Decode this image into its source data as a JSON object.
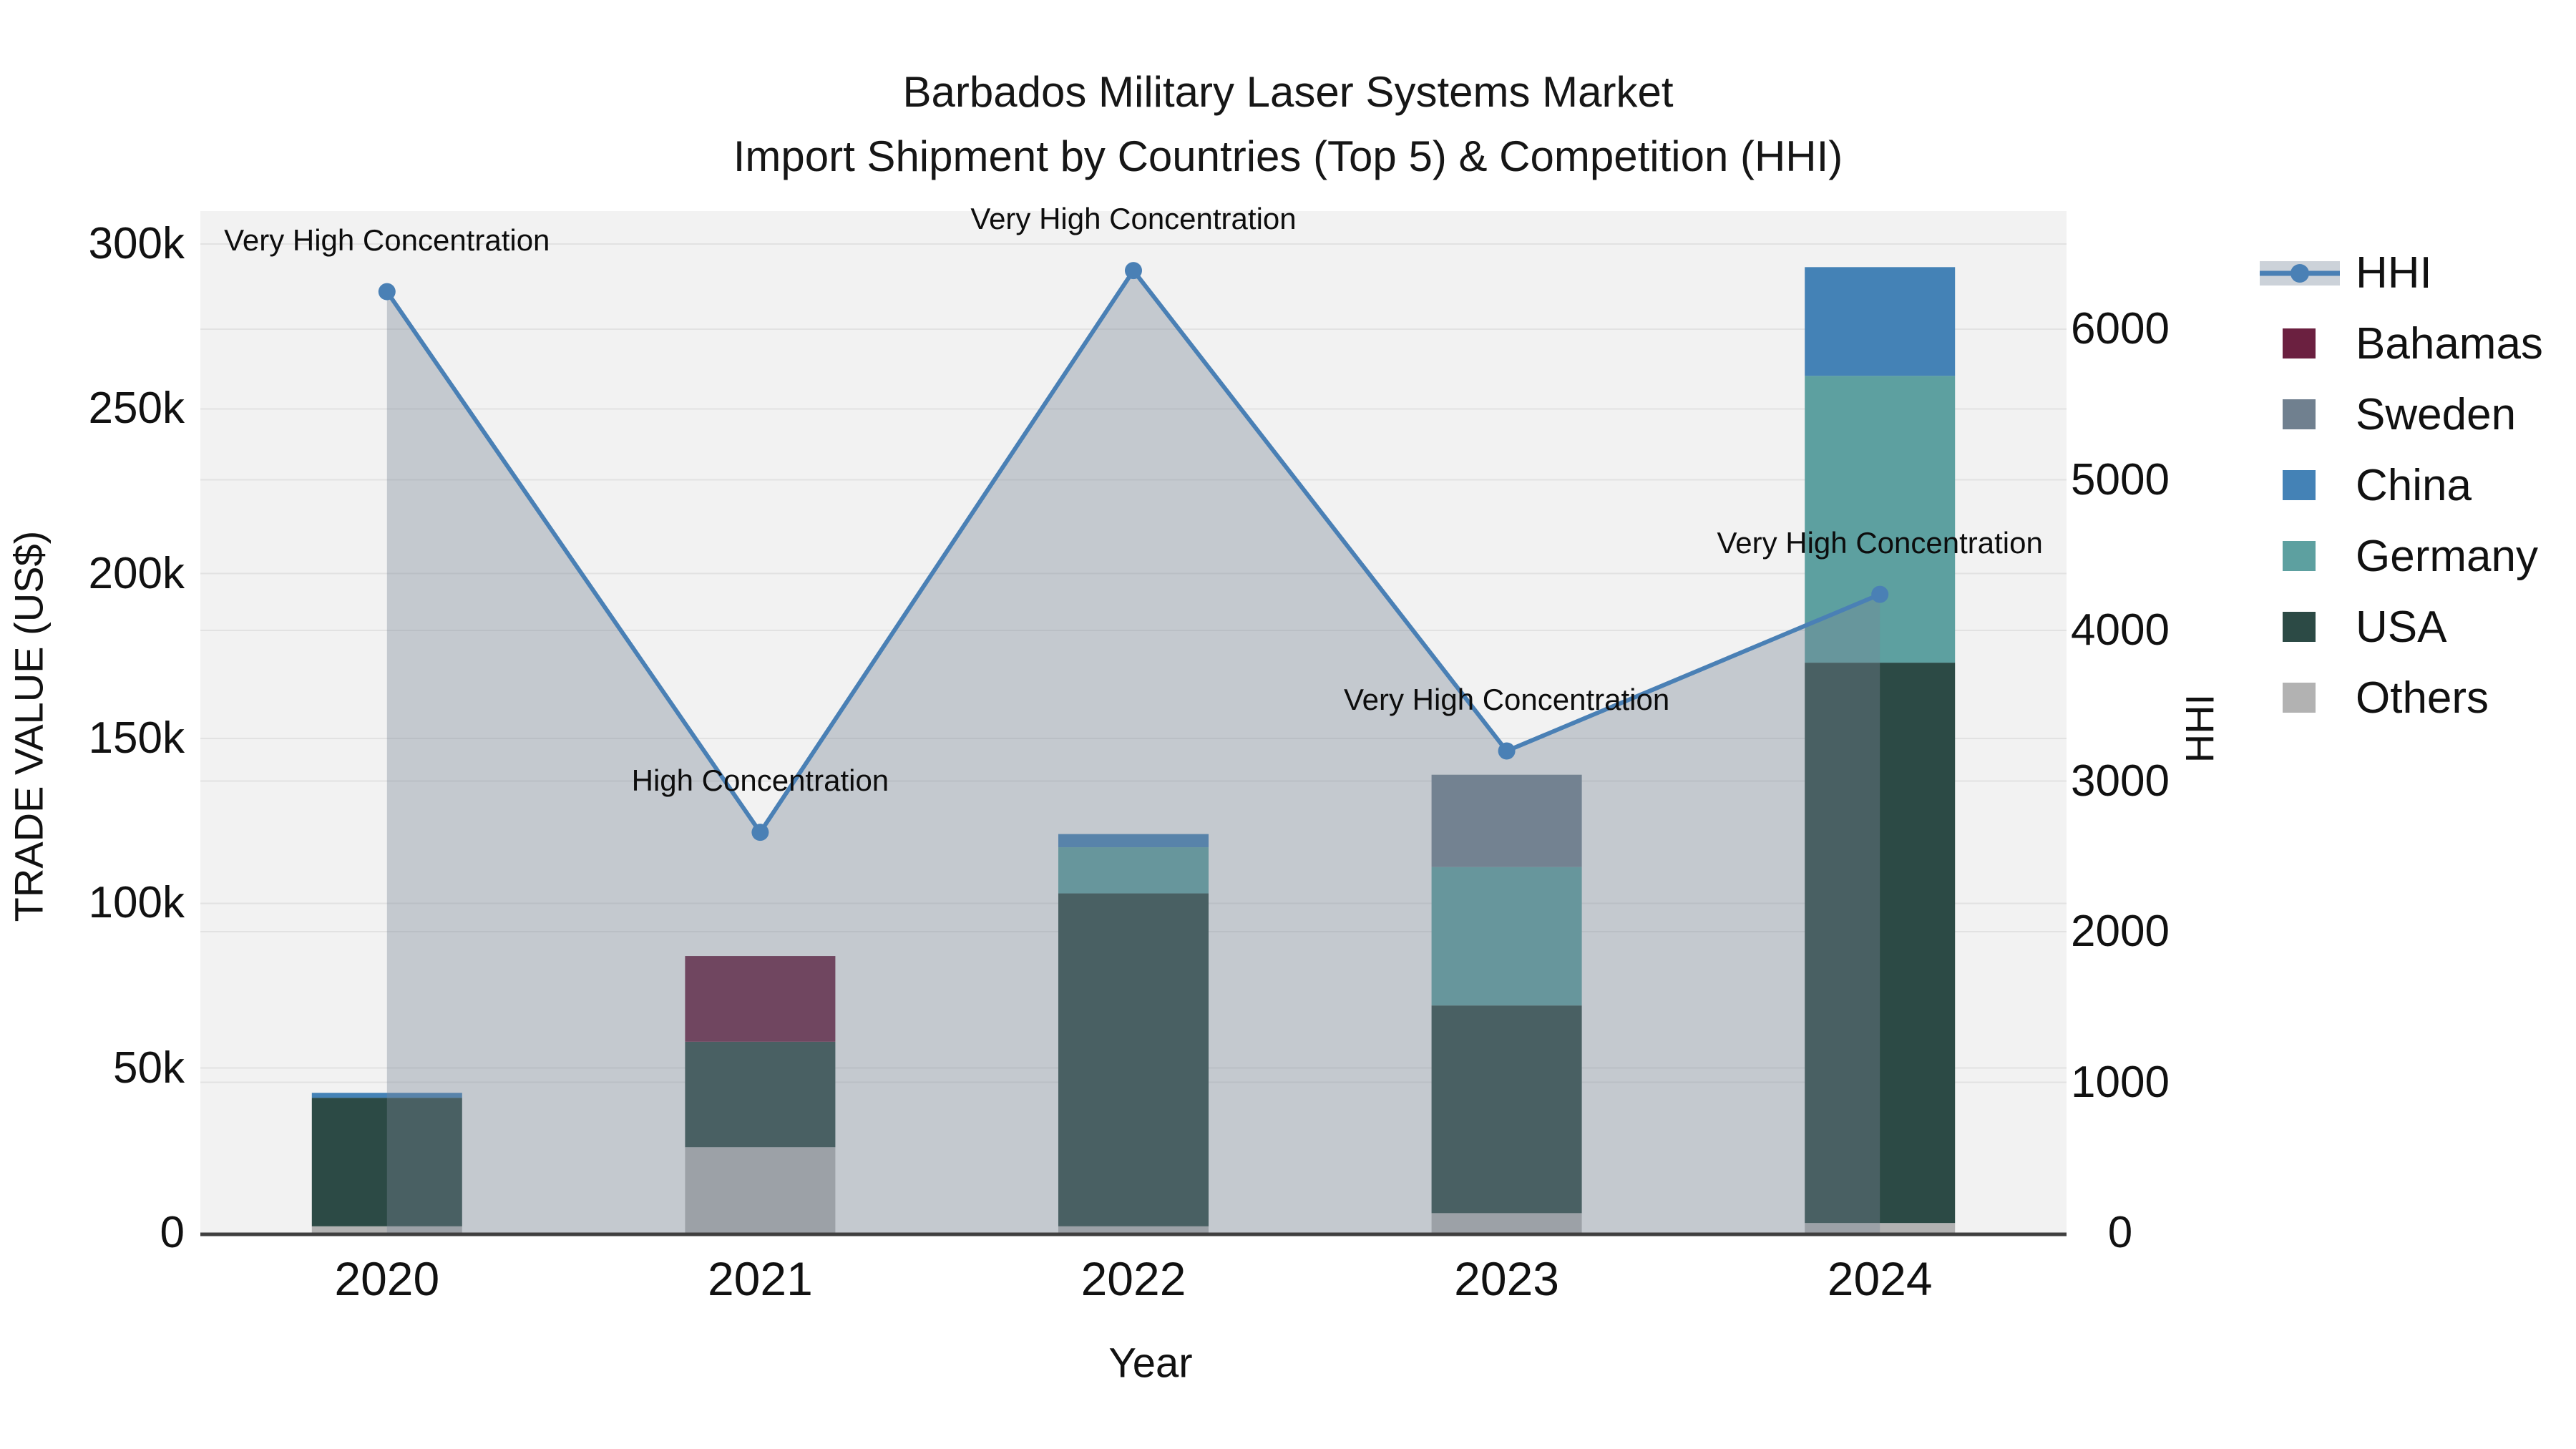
{
  "title": {
    "line1": "Barbados Military Laser Systems Market",
    "line2": "Import Shipment by Countries (Top 5) & Competition (HHI)"
  },
  "axes": {
    "x_title": "Year",
    "y_left_title": "TRADE VALUE (US$)",
    "y_right_title": "HHI",
    "x_tick_labels": [
      "2020",
      "2021",
      "2022",
      "2023",
      "2024"
    ],
    "y_left_tick_labels": [
      "0",
      "50k",
      "100k",
      "150k",
      "200k",
      "250k",
      "300k"
    ],
    "y_left_tick_values": [
      0,
      50000,
      100000,
      150000,
      200000,
      250000,
      300000
    ],
    "y_right_tick_labels": [
      "0",
      "1000",
      "2000",
      "3000",
      "4000",
      "5000",
      "6000"
    ],
    "y_right_tick_values": [
      0,
      1000,
      2000,
      3000,
      4000,
      5000,
      6000
    ]
  },
  "legend": {
    "items": [
      {
        "label": "HHI",
        "type": "line",
        "color": "#4a80b5"
      },
      {
        "label": "Bahamas",
        "type": "swatch",
        "color": "#6b2040"
      },
      {
        "label": "Sweden",
        "type": "swatch",
        "color": "#70808f"
      },
      {
        "label": "China",
        "type": "swatch",
        "color": "#4482b6"
      },
      {
        "label": "Germany",
        "type": "swatch",
        "color": "#5da0a0"
      },
      {
        "label": "USA",
        "type": "swatch",
        "color": "#2c4a45"
      },
      {
        "label": "Others",
        "type": "swatch",
        "color": "#b2b2b2"
      }
    ]
  },
  "colors": {
    "plot_bg": "#f2f2f2",
    "grid": "#e2e2e2",
    "axis_line": "#3f3f3f",
    "text": "#111111",
    "hhi_line": "#4a80b5",
    "hhi_fill": "rgba(121,135,150,0.38)",
    "legend_band": "#ccd2d9"
  },
  "chart_data": {
    "type": "bar+line",
    "title": "Barbados Military Laser Systems Market — Import Shipment by Countries (Top 5) & Competition (HHI)",
    "xlabel": "Year",
    "ylabel_left": "TRADE VALUE (US$)",
    "ylabel_right": "HHI",
    "categories": [
      "2020",
      "2021",
      "2022",
      "2023",
      "2024"
    ],
    "bar_stack_order": [
      "Others",
      "USA",
      "Germany",
      "China",
      "Sweden",
      "Bahamas"
    ],
    "bar_series": [
      {
        "name": "Others",
        "color": "#b2b2b2",
        "values": [
          2000,
          26000,
          2000,
          6000,
          3000
        ]
      },
      {
        "name": "USA",
        "color": "#2c4a45",
        "values": [
          39000,
          32000,
          101000,
          63000,
          170000
        ]
      },
      {
        "name": "Germany",
        "color": "#5da0a0",
        "values": [
          0,
          0,
          14000,
          42000,
          87000
        ]
      },
      {
        "name": "China",
        "color": "#4482b6",
        "values": [
          1500,
          0,
          4000,
          0,
          33000
        ]
      },
      {
        "name": "Sweden",
        "color": "#70808f",
        "values": [
          0,
          0,
          0,
          28000,
          0
        ]
      },
      {
        "name": "Bahamas",
        "color": "#6b2040",
        "values": [
          0,
          26000,
          0,
          0,
          0
        ]
      }
    ],
    "bar_totals": [
      42500,
      84000,
      121000,
      139000,
      293000
    ],
    "line_series": {
      "name": "HHI",
      "axis": "right",
      "values": [
        6250,
        2660,
        6390,
        3200,
        4240
      ]
    },
    "annotations": [
      {
        "category": "2020",
        "text": "Very High Concentration"
      },
      {
        "category": "2021",
        "text": "High Concentration"
      },
      {
        "category": "2022",
        "text": "Very High Concentration"
      },
      {
        "category": "2023",
        "text": "Very High Concentration"
      },
      {
        "category": "2024",
        "text": "Very High Concentration"
      }
    ],
    "y_left_range": [
      0,
      310000
    ],
    "y_right_range": [
      0,
      6785
    ],
    "grid": true,
    "legend_position": "right"
  }
}
